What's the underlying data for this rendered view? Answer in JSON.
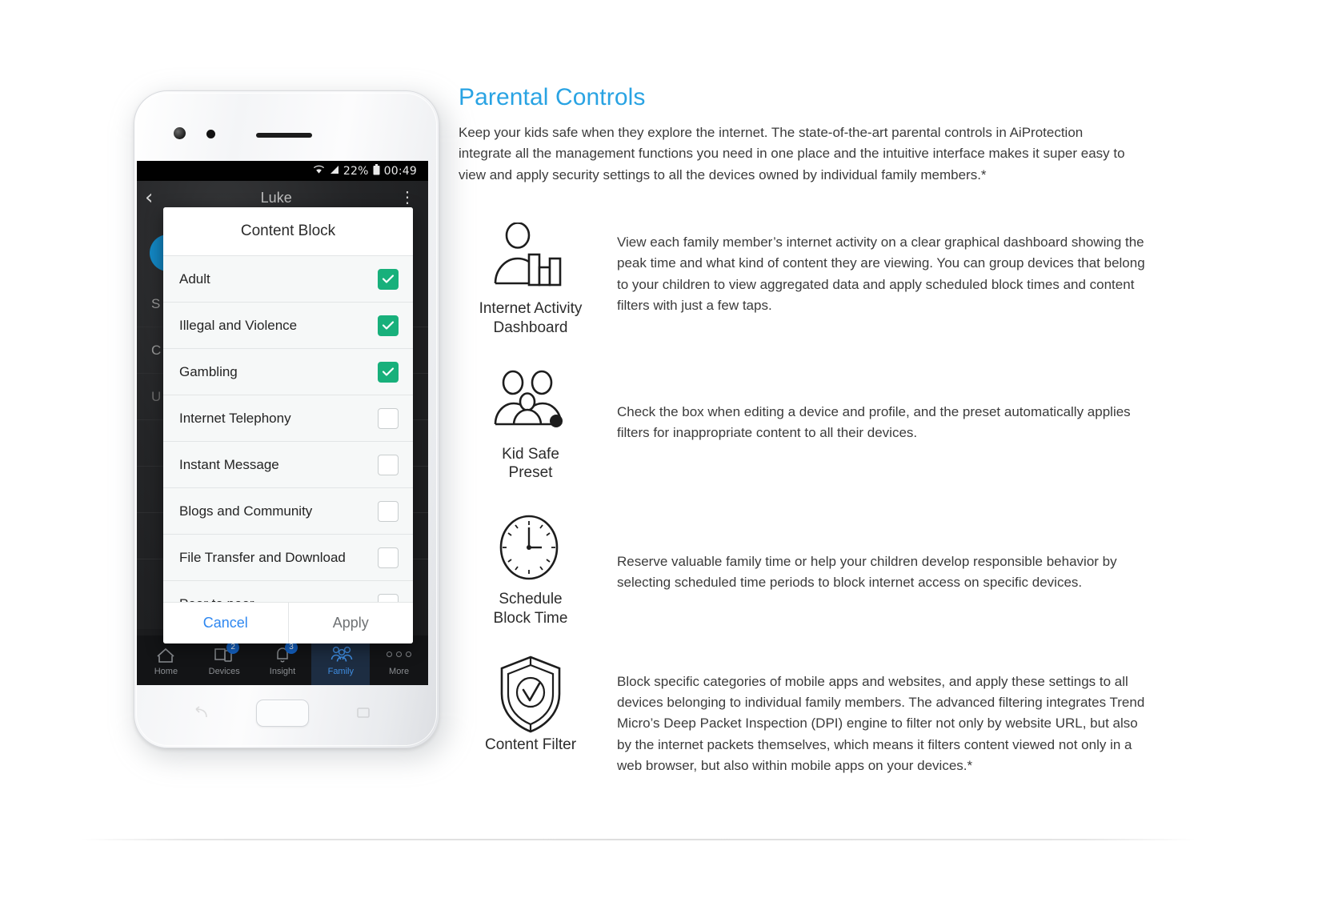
{
  "section": {
    "title": "Parental Controls",
    "intro": "Keep your kids safe when they explore the internet. The state-of-the-art parental controls in AiProtection integrate all the management functions you need in one place and the intuitive interface makes it super easy to view and apply security settings to all the devices owned by individual family members.*"
  },
  "features": [
    {
      "icon": "person-bar-chart-icon",
      "caption": "Internet Activity\nDashboard",
      "text": "View each family member’s internet activity on a clear graphical dashboard showing the peak time and what kind of content they are viewing. You can group devices that belong to your children to view aggregated data and apply scheduled block times and content filters with just a few taps."
    },
    {
      "icon": "family-group-icon",
      "caption": "Kid Safe\nPreset",
      "text": "Check the box when editing a device and profile, and the preset automatically applies filters for inappropriate content to all their devices."
    },
    {
      "icon": "clock-icon",
      "caption": "Schedule\nBlock Time",
      "text": "Reserve valuable family time or help your children develop responsible behavior by selecting scheduled time periods to block internet access on specific devices."
    },
    {
      "icon": "shield-check-icon",
      "caption": "Content Filter",
      "text": "Block specific categories of mobile apps and websites, and apply these settings to all devices belonging to individual family members. The advanced filtering integrates Trend Micro’s Deep Packet Inspection (DPI) engine to filter not only by website URL, but also by the internet packets themselves, which means it filters content viewed not only in a web browser, but also within mobile apps on your devices.*"
    }
  ],
  "phone": {
    "status_bar": {
      "wifi_icon": "wifi-icon",
      "signal_icon": "signal-bars-icon",
      "battery_percent": "22%",
      "battery_icon": "battery-icon",
      "time": "00:49"
    },
    "app": {
      "back_icon": "back-chevron-icon",
      "title": "Luke",
      "menu_icon": "kebab-menu-icon",
      "rows": [
        "S",
        "C",
        "U",
        "",
        "",
        ""
      ]
    },
    "dialog": {
      "title": "Content Block",
      "items": [
        {
          "label": "Adult",
          "checked": true
        },
        {
          "label": "Illegal and Violence",
          "checked": true
        },
        {
          "label": "Gambling",
          "checked": true
        },
        {
          "label": "Internet Telephony",
          "checked": false
        },
        {
          "label": "Instant Message",
          "checked": false
        },
        {
          "label": "Blogs and Community",
          "checked": false
        },
        {
          "label": "File Transfer and Download",
          "checked": false
        },
        {
          "label": "Peer to peer",
          "checked": false
        }
      ],
      "cancel_label": "Cancel",
      "apply_label": "Apply"
    },
    "bottom_nav": [
      {
        "label": "Home",
        "icon": "home-icon",
        "badge": "",
        "active": false
      },
      {
        "label": "Devices",
        "icon": "devices-icon",
        "badge": "2",
        "active": false
      },
      {
        "label": "Insight",
        "icon": "bell-icon",
        "badge": "3",
        "active": false
      },
      {
        "label": "Family",
        "icon": "family-people-icon",
        "badge": "",
        "active": true
      },
      {
        "label": "More",
        "icon": "more-dots-icon",
        "badge": "",
        "active": false
      }
    ]
  },
  "colors": {
    "accent_blue": "#29a3e3",
    "checkbox_green": "#18b07b",
    "link_blue": "#2e87f0",
    "nav_active_blue": "#3f8de0",
    "badge_blue": "#1464c8"
  }
}
